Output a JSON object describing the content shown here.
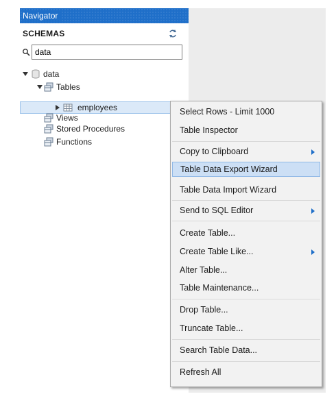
{
  "navigator": {
    "title": "Navigator",
    "schemas_label": "SCHEMAS",
    "search": {
      "value": "data",
      "placeholder": ""
    }
  },
  "tree": {
    "schema": "data",
    "tables_folder": "Tables",
    "table_selected": "employees",
    "views_folder": "Views",
    "procedures_folder": "Stored Procedures",
    "functions_folder": "Functions"
  },
  "context_menu": {
    "items": [
      "Select Rows - Limit 1000",
      "Table Inspector",
      "Copy to Clipboard",
      "Table Data Export Wizard",
      "Table Data Import Wizard",
      "Send to SQL Editor",
      "Create Table...",
      "Create Table Like...",
      "Alter Table...",
      "Table Maintenance...",
      "Drop Table...",
      "Truncate Table...",
      "Search Table Data...",
      "Refresh All"
    ],
    "highlighted": "Table Data Export Wizard"
  },
  "colors": {
    "header_blue": "#1f6fc9",
    "selection": "#dbe9f8",
    "menu_highlight": "#ccdff5",
    "menu_bg": "#f2f2f2"
  },
  "icons": [
    "refresh-icon",
    "search-icon",
    "database-icon",
    "folder-tables-icon",
    "table-icon",
    "expand-arrow-icon",
    "collapse-arrow-icon",
    "submenu-arrow-icon"
  ]
}
